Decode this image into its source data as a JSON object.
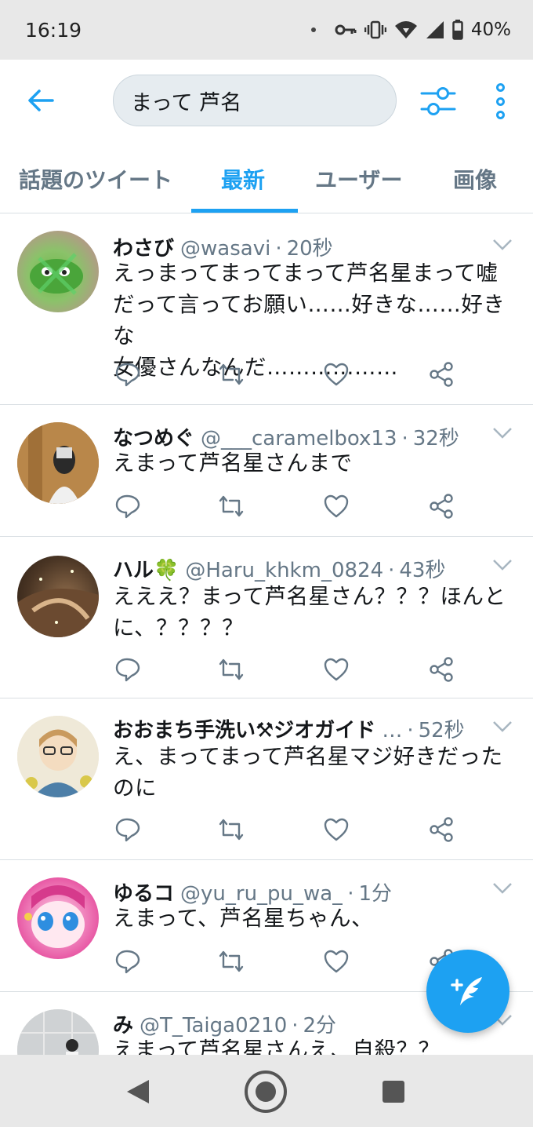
{
  "status_bar": {
    "time": "16:19",
    "battery": "40%",
    "icons": [
      "notification-dot-icon",
      "vpn-key-icon",
      "vibrate-icon",
      "wifi-icon",
      "signal-icon",
      "battery-icon"
    ]
  },
  "header": {
    "back_icon": "arrow-left-icon",
    "search_value": "まって 芦名",
    "filter_icon": "sliders-icon",
    "more_icon": "more-vertical-icon"
  },
  "tabs": [
    {
      "label": "話題のツイート",
      "active": false
    },
    {
      "label": "最新",
      "active": true
    },
    {
      "label": "ユーザー",
      "active": false
    },
    {
      "label": "画像",
      "active": false
    }
  ],
  "tweets": [
    {
      "name": "わさび",
      "handle": "@wasavi",
      "time": "20秒",
      "text": "えっまってまってまって芦名星まって嘘\nだって言ってお願い……好きな……好きな\n女優さんなんだ………………"
    },
    {
      "name": "なつめぐ",
      "handle": "@___caramelbox13",
      "time": "32秒",
      "text": "えまって芦名星さんまで"
    },
    {
      "name": "ハル🍀",
      "handle": "@Haru_khkm_0824",
      "time": "43秒",
      "text": "えええ？まって芦名星さん？？？ほんと\nに、？？？？"
    },
    {
      "name": "おおまち手洗い⚒ジオガイド",
      "handle": "…",
      "time": "52秒",
      "text": "え、まってまって芦名星マジ好きだった\nのに"
    },
    {
      "name": "ゆるコ",
      "handle": "@yu_ru_pu_wa_",
      "time": "1分",
      "text": "えまって、芦名星ちゃん、"
    },
    {
      "name": "み",
      "handle": "@T_Taiga0210",
      "time": "2分",
      "text": "えまって芦名星さんえ、自殺？？"
    }
  ],
  "action_icons": [
    "reply-icon",
    "retweet-icon",
    "like-icon",
    "share-icon"
  ],
  "fab": {
    "icon": "compose-tweet-icon"
  },
  "nav": {
    "icons": [
      "nav-back-icon",
      "nav-home-icon",
      "nav-recents-icon"
    ]
  },
  "colors": {
    "accent": "#1da1f2",
    "text": "#14171a",
    "secondary": "#657786",
    "divider": "#d9dfe3"
  }
}
